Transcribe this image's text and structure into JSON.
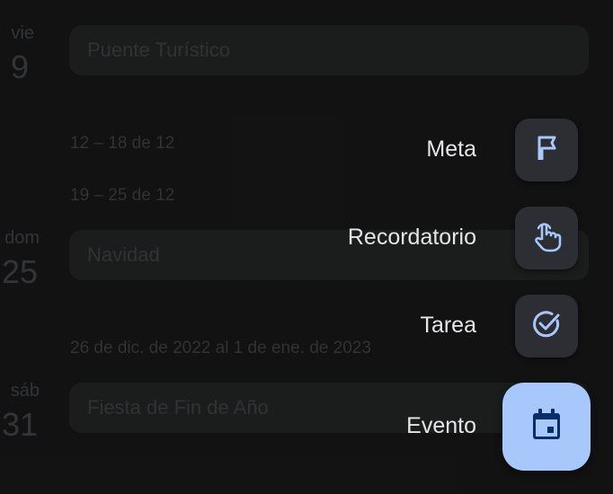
{
  "calendar": {
    "days": [
      {
        "weekday": "vie",
        "number": "9",
        "event": "Puente Turístico"
      },
      {
        "weekday": "dom",
        "number": "25",
        "event": "Navidad"
      },
      {
        "weekday": "sáb",
        "number": "31",
        "event": "Fiesta de Fin de Año"
      }
    ],
    "week_ranges": [
      "12 – 18 de 12",
      "19 – 25 de 12",
      "26 de dic. de 2022 al 1 de ene. de 2023"
    ]
  },
  "fab_menu": {
    "items": [
      {
        "label": "Meta",
        "icon": "flag-icon"
      },
      {
        "label": "Recordatorio",
        "icon": "pointing-hand-icon"
      },
      {
        "label": "Tarea",
        "icon": "check-circle-icon"
      },
      {
        "label": "Evento",
        "icon": "calendar-event-icon"
      }
    ]
  },
  "colors": {
    "background": "#161617",
    "mini_fab": "#2c2e33",
    "main_fab": "#a8c7fa",
    "icon_accent": "#a8c7fa",
    "main_icon": "#062e6f",
    "label_text": "#e6e6e8"
  }
}
